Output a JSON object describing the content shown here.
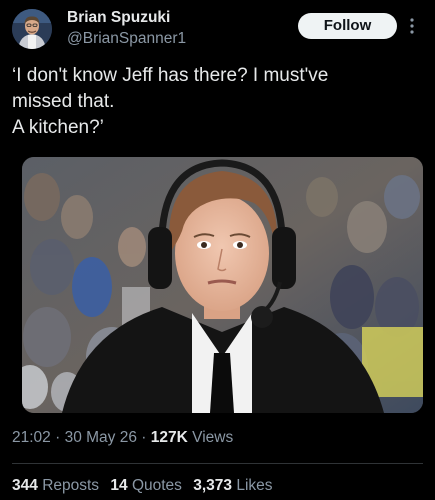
{
  "author": {
    "name": "Brian Spuzuki",
    "handle": "@BrianSpanner1"
  },
  "follow_label": "Follow",
  "tweet": {
    "lines": [
      "‘I don't know Jeff has there? I must've",
      "missed that.",
      "A kitchen?’"
    ]
  },
  "meta": {
    "time": "21:02",
    "separator": "·",
    "date": "30 May 26",
    "views_count": "127K",
    "views_label": "Views"
  },
  "stats": {
    "reposts_count": "344",
    "reposts_label": "Reposts",
    "quotes_count": "14",
    "quotes_label": "Quotes",
    "likes_count": "3,373",
    "likes_label": "Likes"
  },
  "icons": [
    "more-options-icon"
  ],
  "colors": {
    "background": "#000000",
    "text": "#e7e9ea",
    "muted": "#8b98a5",
    "button_bg": "#eff3f4"
  }
}
